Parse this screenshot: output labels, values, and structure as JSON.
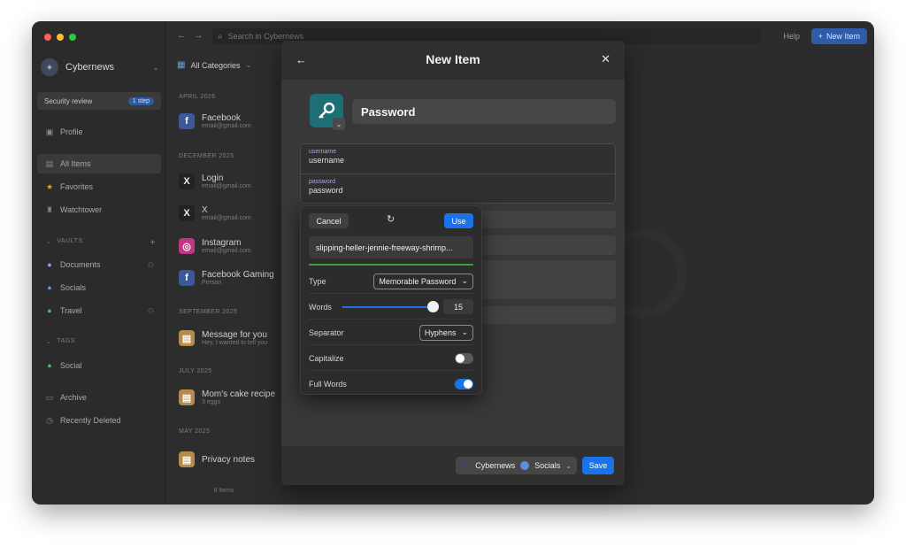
{
  "sidebar": {
    "account": "Cybernews",
    "security_review": {
      "label": "Security review",
      "badge": "1 step"
    },
    "items": [
      {
        "label": "Profile"
      },
      {
        "label": "All Items"
      },
      {
        "label": "Favorites"
      },
      {
        "label": "Watchtower"
      }
    ],
    "vaults_header": "VAULTS",
    "vaults": [
      {
        "label": "Documents"
      },
      {
        "label": "Socials"
      },
      {
        "label": "Travel"
      }
    ],
    "tags_header": "TAGS",
    "tags": [
      {
        "label": "Social"
      }
    ],
    "bottom": [
      {
        "label": "Archive"
      },
      {
        "label": "Recently Deleted"
      }
    ]
  },
  "list": {
    "filter": "All Categories",
    "groups": [
      {
        "header": "APRIL 2026",
        "items": [
          {
            "title": "Facebook",
            "sub": "email@gmail.com"
          }
        ]
      },
      {
        "header": "DECEMBER 2025",
        "items": [
          {
            "title": "Login",
            "sub": "email@gmail.com"
          },
          {
            "title": "X",
            "sub": "email@gmail.com"
          },
          {
            "title": "Instagram",
            "sub": "email@gmail.com"
          },
          {
            "title": "Facebook Gaming",
            "sub": "Person"
          }
        ]
      },
      {
        "header": "SEPTEMBER 2025",
        "items": [
          {
            "title": "Message for you",
            "sub": "Hey, I wanted to tell you"
          }
        ]
      },
      {
        "header": "JULY 2025",
        "items": [
          {
            "title": "Mom's cake recipe",
            "sub": "3 eggs"
          }
        ]
      },
      {
        "header": "MAY 2025",
        "items": [
          {
            "title": "Privacy notes",
            "sub": ""
          }
        ]
      }
    ],
    "count": "8 Items"
  },
  "topbar": {
    "search_placeholder": "Search in Cybernews",
    "help": "Help",
    "new_item": "New Item"
  },
  "modal": {
    "title": "New Item",
    "item_name": "Password",
    "fields": [
      {
        "label": "username",
        "value": "username"
      },
      {
        "label": "password",
        "value": "password"
      }
    ],
    "footer": {
      "vault_account": "Cybernews",
      "vault_name": "Socials",
      "save": "Save"
    }
  },
  "generator": {
    "cancel": "Cancel",
    "use": "Use",
    "password": "slipping-heller-jennie-freeway-shrimp...",
    "type_label": "Type",
    "type_value": "Memorable Password",
    "words_label": "Words",
    "words_value": "15",
    "words_fraction": 1.0,
    "separator_label": "Separator",
    "separator_value": "Hyphens",
    "capitalize_label": "Capitalize",
    "capitalize_on": false,
    "full_words_label": "Full Words",
    "full_words_on": true
  },
  "colors": {
    "accent": "#1a73e8",
    "strength": "#3ca33c",
    "key_tile": "#1e6e76",
    "field_label": "#b39bff"
  },
  "icons": [
    "search-icon",
    "key-icon",
    "close-icon",
    "back-arrow-icon",
    "refresh-icon",
    "chevron-down-icon",
    "plus-icon"
  ]
}
